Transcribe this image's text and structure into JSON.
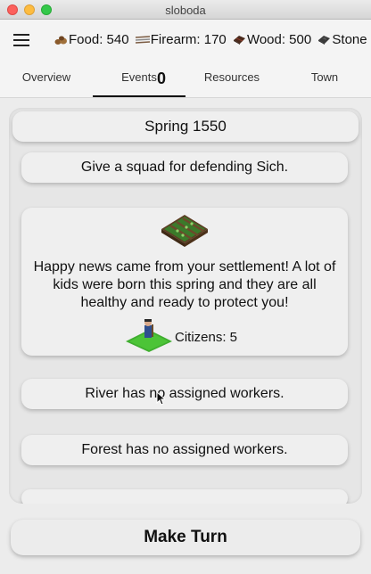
{
  "window": {
    "title": "sloboda"
  },
  "resources": [
    {
      "icon": "food-icon",
      "label": "Food: 540"
    },
    {
      "icon": "firearm-icon",
      "label": "Firearm: 170"
    },
    {
      "icon": "wood-icon",
      "label": "Wood: 500"
    },
    {
      "icon": "stone-icon",
      "label": "Stone"
    }
  ],
  "tabs": [
    {
      "label": "Overview"
    },
    {
      "label": "Events",
      "active": true
    },
    {
      "label": "Resources"
    },
    {
      "label": "Town"
    }
  ],
  "events_count": "0",
  "season": "Spring 1550",
  "quest": "Give a squad for defending Sich.",
  "event": {
    "icon": "farm-field-icon",
    "text": "Happy news came from your settlement! A lot of kids were born this spring and they are all healthy and ready to protect you!",
    "footer_icon": "citizen-icon",
    "footer": "Citizens: 5"
  },
  "notices": [
    "River has no assigned workers.",
    "Forest has no assigned workers."
  ],
  "make_turn": "Make Turn",
  "colors": {
    "grass": "#3fae2f",
    "background": "#ececec",
    "card": "#efefef"
  }
}
